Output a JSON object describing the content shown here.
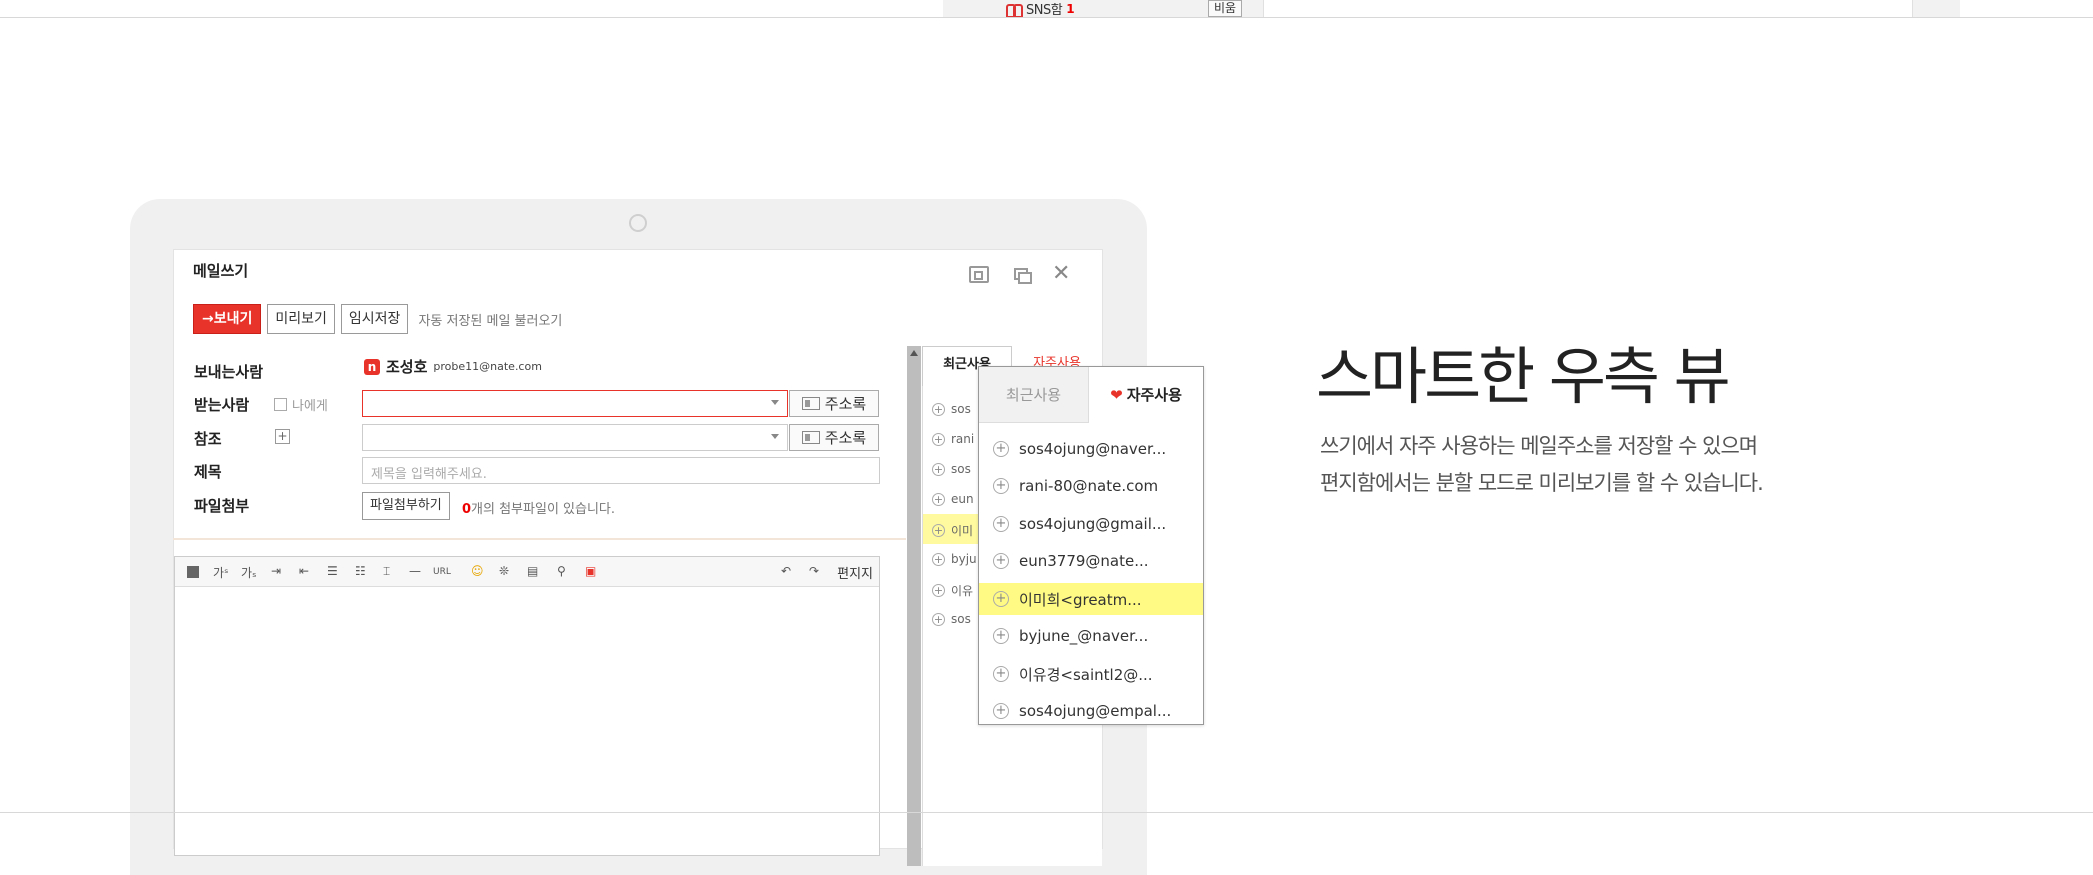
{
  "top_strip": {
    "sns_label": "SNS함",
    "sns_count": "1",
    "empty_button": "비움"
  },
  "compose": {
    "title": "메일쓰기",
    "send_button": "→보내기",
    "preview_button": "미리보기",
    "draft_button": "임시저장",
    "autosave_text": "자동 저장된 메일 불러오기",
    "labels": {
      "from": "보내는사람",
      "to": "받는사람",
      "cc": "참조",
      "subject": "제목",
      "attach": "파일첨부"
    },
    "to_me": "나에게",
    "sender_icon": "n",
    "sender_name": "조성호",
    "sender_email": "probe11@nate.com",
    "address_book": "주소록",
    "subject_placeholder": "제목을 입력해주세요.",
    "attach_button": "파일첨부하기",
    "attach_count": "0",
    "attach_note": "개의 첨부파일이 있습니다.",
    "editor_right_label": "편지지"
  },
  "side_panel": {
    "tab_recent": "최근사용",
    "tab_fav": "자주사용",
    "rows": [
      "sos",
      "rani",
      "sos",
      "eun",
      "이미",
      "byju",
      "이유",
      "sos"
    ]
  },
  "popup": {
    "tab_recent": "최근사용",
    "tab_fav": "자주사용",
    "items": [
      "sos4ojung@naver...",
      "rani-80@nate.com",
      "sos4ojung@gmail...",
      "eun3779@nate...",
      "이미희<greatm...",
      "byjune_@naver...",
      "이유경<saintl2@...",
      "sos4ojung@empal..."
    ],
    "highlighted_index": 4
  },
  "feature": {
    "heading": "스마트한 우측 뷰",
    "desc_line1": "쓰기에서 자주 사용하는 메일주소를 저장할 수 있으며",
    "desc_line2": "편지함에서는 분할 모드로 미리보기를 할 수 있습니다."
  },
  "colors": {
    "accent": "#e8332a",
    "highlight": "#fffa84"
  }
}
